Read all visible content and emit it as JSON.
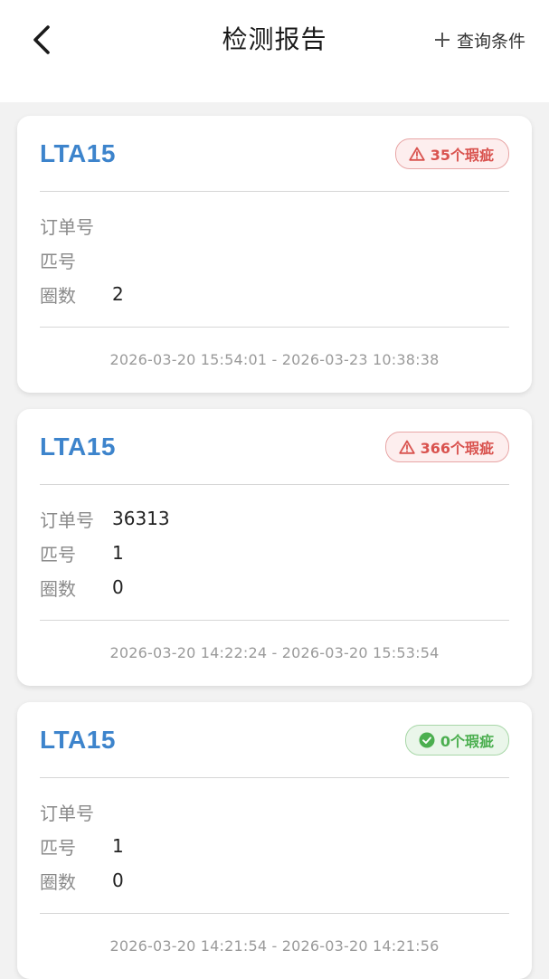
{
  "header": {
    "title": "检测报告",
    "query_label": "查询条件"
  },
  "colors": {
    "accent": "#3d84cc",
    "warn": "#d9534f",
    "ok": "#4caf50"
  },
  "labels": {
    "order": "订单号",
    "piece": "匹号",
    "turns": "圈数"
  },
  "cards": [
    {
      "model": "LTA15",
      "badge": {
        "text": "35个瑕疵",
        "status": "warn",
        "icon": "warning-icon"
      },
      "order": "",
      "piece": "",
      "turns": "2",
      "time_range": "2026-03-20 15:54:01 - 2026-03-23 10:38:38"
    },
    {
      "model": "LTA15",
      "badge": {
        "text": "366个瑕疵",
        "status": "warn",
        "icon": "warning-icon"
      },
      "order": "36313",
      "piece": "1",
      "turns": "0",
      "time_range": "2026-03-20 14:22:24 - 2026-03-20 15:53:54"
    },
    {
      "model": "LTA15",
      "badge": {
        "text": "0个瑕疵",
        "status": "ok",
        "icon": "check-circle-icon"
      },
      "order": "",
      "piece": "1",
      "turns": "0",
      "time_range": "2026-03-20 14:21:54 - 2026-03-20 14:21:56"
    }
  ]
}
